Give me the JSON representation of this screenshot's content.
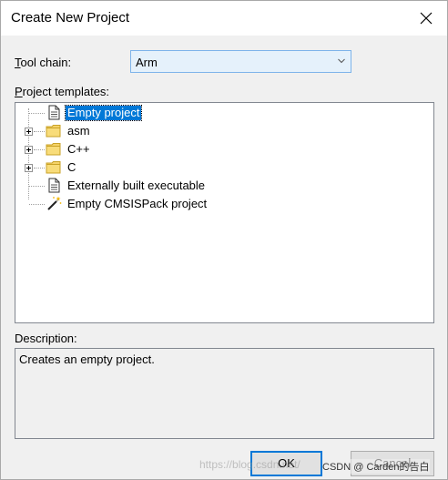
{
  "window": {
    "title": "Create New Project",
    "close_icon": "close-icon"
  },
  "toolchain": {
    "label_underlined": "T",
    "label_rest": "ool chain:",
    "value": "Arm"
  },
  "templates": {
    "label_underlined": "P",
    "label_rest": "roject templates:",
    "items": [
      {
        "label": "Empty project",
        "icon": "document-icon",
        "expandable": false,
        "selected": true
      },
      {
        "label": "asm",
        "icon": "folder-icon",
        "expandable": true,
        "selected": false
      },
      {
        "label": "C++",
        "icon": "folder-icon",
        "expandable": true,
        "selected": false
      },
      {
        "label": "C",
        "icon": "folder-icon",
        "expandable": true,
        "selected": false
      },
      {
        "label": "Externally built executable",
        "icon": "document-icon",
        "expandable": false,
        "selected": false
      },
      {
        "label": "Empty CMSISPack project",
        "icon": "magic-wand-icon",
        "expandable": false,
        "selected": false
      }
    ]
  },
  "description": {
    "label": "Description:",
    "text": "Creates an empty project."
  },
  "buttons": {
    "ok": "OK",
    "cancel": "Cancel"
  },
  "watermark": {
    "url_text": "https://blog.csdn.net/",
    "brand_text": "CSDN @ Carden的告白"
  },
  "colors": {
    "selection": "#0078d7",
    "folder": "#f5d36a",
    "combo_bg": "#e5f1fb"
  }
}
